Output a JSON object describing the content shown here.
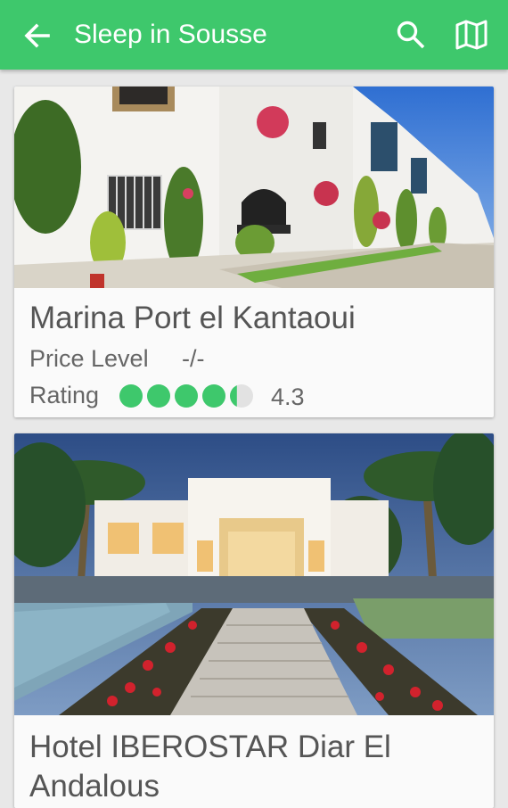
{
  "app_bar": {
    "title": "Sleep in Sousse",
    "back_icon": "arrow-back-icon",
    "search_icon": "search-icon",
    "map_icon": "map-icon",
    "color": "#3ec86c"
  },
  "hotels": [
    {
      "name": "Marina Port el Kantaoui",
      "price_label": "Price Level",
      "price_value": "-/-",
      "rating_label": "Rating",
      "rating": 4.3,
      "rating_text": "4.3",
      "rating_max": 5,
      "rating_color": "#3ec86c"
    },
    {
      "name": "Hotel IBEROSTAR Diar El Andalous"
    }
  ]
}
